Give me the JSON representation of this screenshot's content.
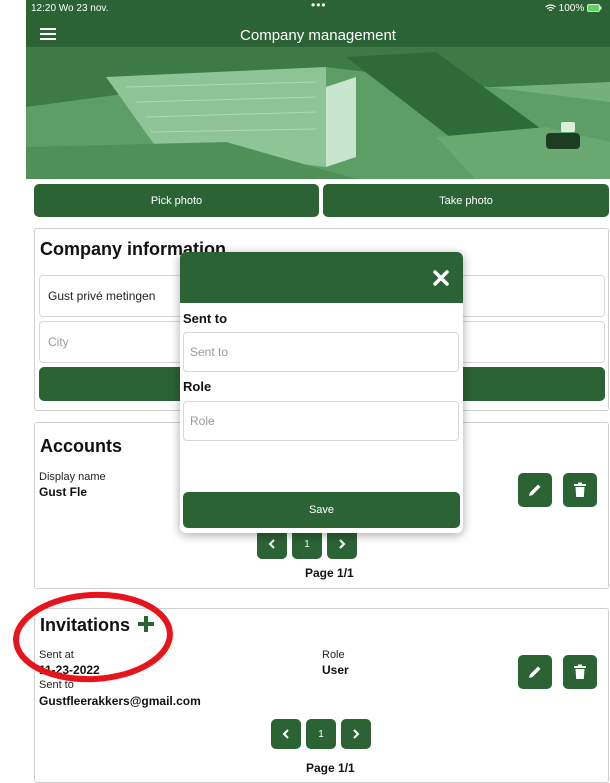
{
  "status_bar": {
    "time": "12:20  Wo 23 nov.",
    "dots": "•••",
    "battery": "100%"
  },
  "header": {
    "title": "Company management"
  },
  "photo_actions": {
    "pick": "Pick photo",
    "take": "Take photo"
  },
  "company_info": {
    "title": "Company information",
    "name_value": "Gust privé metingen",
    "city_placeholder": "City"
  },
  "accounts": {
    "title": "Accounts",
    "display_name_label": "Display name",
    "display_name_value": "Gust Fle",
    "page_number": "1",
    "page_label": "Page 1/1"
  },
  "invitations": {
    "title": "Invitations",
    "add_icon": "plus-icon",
    "sent_at_label": "Sent at",
    "sent_at_value": "11-23-2022",
    "role_label": "Role",
    "role_value": "User",
    "sent_to_label": "Sent to",
    "sent_to_value": "Gustfleerakkers@gmail.com",
    "page_number": "1",
    "page_label": "Page 1/1"
  },
  "modal": {
    "sent_to_label": "Sent to",
    "sent_to_placeholder": "Sent to",
    "role_label": "Role",
    "role_placeholder": "Role",
    "save_label": "Save"
  },
  "colors": {
    "primary": "#2c6335",
    "annotation": "#e8141b"
  }
}
